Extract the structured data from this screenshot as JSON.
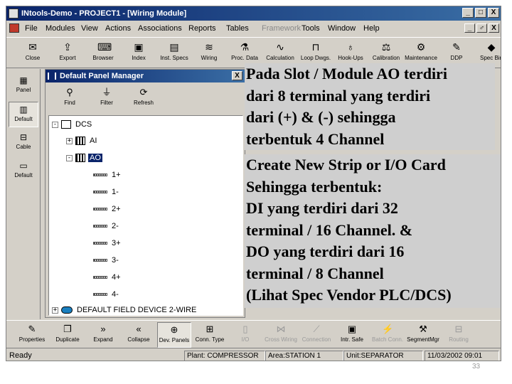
{
  "window": {
    "title": "INtools-Demo - PROJECT1 - [Wiring Module]",
    "controls": [
      "_",
      "□",
      "X"
    ],
    "mdi_controls": [
      "_",
      "♂",
      "X"
    ]
  },
  "menu": [
    {
      "label": "File",
      "disabled": false
    },
    {
      "label": "Modules",
      "disabled": false
    },
    {
      "label": "View",
      "disabled": false
    },
    {
      "label": "Actions",
      "disabled": false
    },
    {
      "label": "Associations",
      "disabled": false
    },
    {
      "label": "Reports",
      "disabled": false
    },
    {
      "label": "Tables",
      "disabled": false
    },
    {
      "label": "Framework",
      "disabled": true
    },
    {
      "label": "Tools",
      "disabled": false
    },
    {
      "label": "Window",
      "disabled": false
    },
    {
      "label": "Help",
      "disabled": false
    }
  ],
  "toolbar": [
    {
      "label": "Close",
      "icon": "close-icon",
      "glyph": "✉"
    },
    {
      "label": "Export",
      "icon": "export-icon",
      "glyph": "⇪"
    },
    {
      "label": "Browser",
      "icon": "browser-icon",
      "glyph": "⌨"
    },
    {
      "label": "Index",
      "icon": "index-icon",
      "glyph": "▣"
    },
    {
      "label": "Inst. Specs",
      "icon": "inst-specs-icon",
      "glyph": "▤"
    },
    {
      "label": "Wiring",
      "icon": "wiring-icon",
      "glyph": "≋"
    },
    {
      "label": "Proc. Data",
      "icon": "proc-data-icon",
      "glyph": "⚗"
    },
    {
      "label": "Calculation",
      "icon": "calculation-icon",
      "glyph": "∿"
    },
    {
      "label": "Loop Dwgs.",
      "icon": "loop-dwgs-icon",
      "glyph": "⊓"
    },
    {
      "label": "Hook-Ups",
      "icon": "hook-ups-icon",
      "glyph": "♁"
    },
    {
      "label": "Calibration",
      "icon": "calibration-icon",
      "glyph": "⚖"
    },
    {
      "label": "Maintenance",
      "icon": "maintenance-icon",
      "glyph": "⚙"
    },
    {
      "label": "DDP",
      "icon": "ddp-icon",
      "glyph": "✎"
    },
    {
      "label": "Spec Bin",
      "icon": "spec-bin-icon",
      "glyph": "◆"
    }
  ],
  "leftbar": [
    {
      "label": "Panel",
      "icon": "panel-icon",
      "glyph": "▦",
      "selected": false
    },
    {
      "label": "Default",
      "icon": "default-icon",
      "glyph": "▥",
      "selected": true
    },
    {
      "label": "Cable",
      "icon": "cable-icon",
      "glyph": "⊟",
      "selected": false
    },
    {
      "label": "Default",
      "icon": "default-icon",
      "glyph": "▭",
      "selected": false
    }
  ],
  "panel": {
    "title": "Default Panel Manager",
    "close": "X",
    "tools": [
      {
        "label": "Find",
        "icon": "binoculars-icon",
        "glyph": "⚲"
      },
      {
        "label": "Filter",
        "icon": "filter-icon",
        "glyph": "⏚"
      },
      {
        "label": "Refresh",
        "icon": "refresh-icon",
        "glyph": "⟳"
      }
    ],
    "tree": [
      {
        "label": "DCS",
        "level": 0,
        "expander": "-",
        "icon": "dcs",
        "selected": false
      },
      {
        "label": "AI",
        "level": 1,
        "expander": "+",
        "icon": "rack",
        "selected": false
      },
      {
        "label": "AO",
        "level": 1,
        "expander": "-",
        "icon": "rack",
        "selected": true
      },
      {
        "label": "1+",
        "level": 2,
        "expander": "",
        "icon": "term",
        "selected": false
      },
      {
        "label": "1-",
        "level": 2,
        "expander": "",
        "icon": "term",
        "selected": false
      },
      {
        "label": "2+",
        "level": 2,
        "expander": "",
        "icon": "term",
        "selected": false
      },
      {
        "label": "2-",
        "level": 2,
        "expander": "",
        "icon": "term",
        "selected": false
      },
      {
        "label": "3+",
        "level": 2,
        "expander": "",
        "icon": "term",
        "selected": false
      },
      {
        "label": "3-",
        "level": 2,
        "expander": "",
        "icon": "term",
        "selected": false
      },
      {
        "label": "4+",
        "level": 2,
        "expander": "",
        "icon": "term",
        "selected": false
      },
      {
        "label": "4-",
        "level": 2,
        "expander": "",
        "icon": "term",
        "selected": false
      },
      {
        "label": "DEFAULT FIELD DEVICE 2-WIRE",
        "level": 0,
        "expander": "+",
        "icon": "device",
        "selected": false
      }
    ]
  },
  "bottombar": [
    {
      "label": "Properties",
      "icon": "properties-icon",
      "glyph": "✎",
      "disabled": false,
      "pressed": false
    },
    {
      "label": "Duplicate",
      "icon": "duplicate-icon",
      "glyph": "❐",
      "disabled": false,
      "pressed": false
    },
    {
      "label": "Expand",
      "icon": "expand-icon",
      "glyph": "»",
      "disabled": false,
      "pressed": false
    },
    {
      "label": "Collapse",
      "icon": "collapse-icon",
      "glyph": "«",
      "disabled": false,
      "pressed": false
    },
    {
      "label": "Dev. Panels",
      "icon": "dev-panels-icon",
      "glyph": "⊕",
      "disabled": false,
      "pressed": true
    },
    {
      "label": "Conn. Type",
      "icon": "conn-type-icon",
      "glyph": "⊞",
      "disabled": false,
      "pressed": false
    },
    {
      "label": "I/O",
      "icon": "io-icon",
      "glyph": "▯",
      "disabled": true,
      "pressed": false
    },
    {
      "label": "Cross Wiring",
      "icon": "cross-wiring-icon",
      "glyph": "⋈",
      "disabled": true,
      "pressed": false
    },
    {
      "label": "Connection",
      "icon": "connection-icon",
      "glyph": "⟋",
      "disabled": true,
      "pressed": false
    },
    {
      "label": "Intr. Safe",
      "icon": "intr-safe-icon",
      "glyph": "▣",
      "disabled": false,
      "pressed": false
    },
    {
      "label": "Batch Conn.",
      "icon": "batch-conn-icon",
      "glyph": "⚡",
      "disabled": true,
      "pressed": false
    },
    {
      "label": "SegmentMgr",
      "icon": "segment-mgr-icon",
      "glyph": "⚒",
      "disabled": false,
      "pressed": false
    },
    {
      "label": "Routing",
      "icon": "routing-icon",
      "glyph": "⊟",
      "disabled": true,
      "pressed": false
    }
  ],
  "status": {
    "ready": "Ready",
    "plant": "Plant: COMPRESSOR",
    "area": "Area:STATION 1",
    "unit": "Unit:SEPARATOR",
    "datetime": "11/03/2002  09:01"
  },
  "overlay": {
    "block1": [
      "Pada Slot / Module AO terdiri",
      "dari 8 terminal yang terdiri",
      "dari (+) & (-) sehingga",
      "terbentuk 4 Channel"
    ],
    "block2": [
      "Create New Strip or I/O Card",
      "Sehingga terbentuk:",
      "DI yang terdiri dari 32",
      "terminal / 16 Channel. &",
      "DO yang terdiri dari 16",
      "terminal / 8 Channel",
      "(Lihat Spec Vendor PLC/DCS)"
    ]
  },
  "page_number": "33",
  "colors": {
    "titlebar_start": "#0a246a",
    "titlebar_end": "#3a6ea5",
    "chrome": "#d4d0c8",
    "selection": "#0a246a",
    "overlay_bg": "#cfcfcf"
  }
}
